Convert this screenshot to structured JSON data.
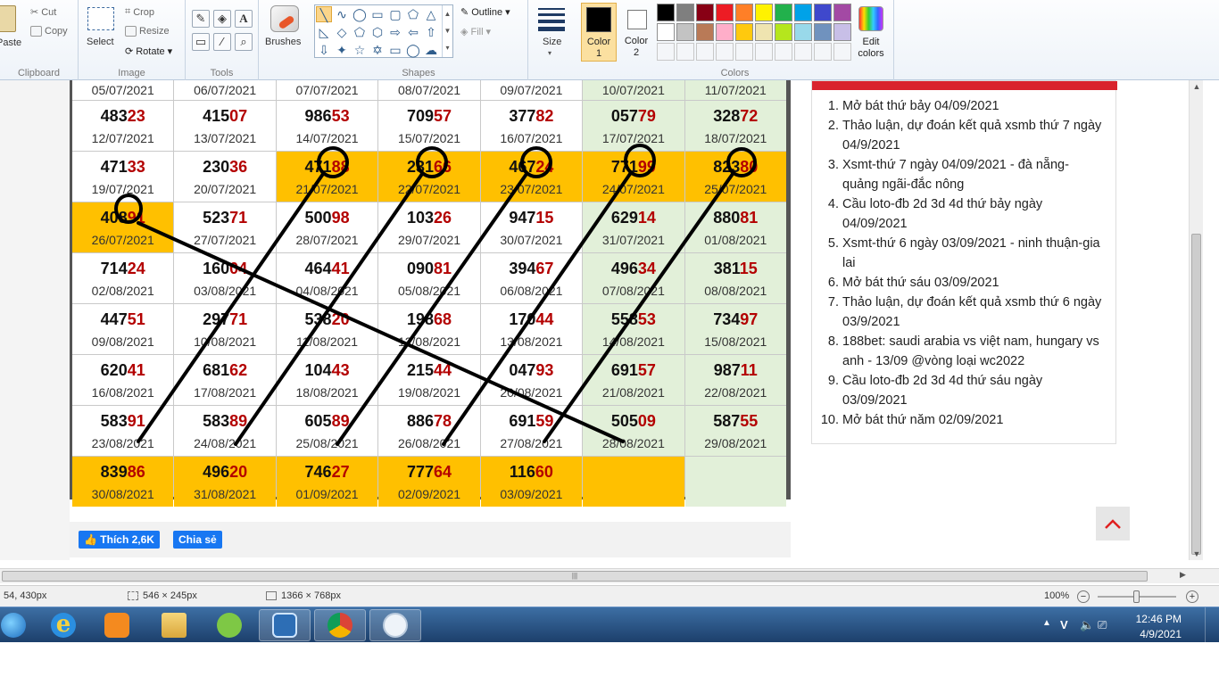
{
  "ribbon": {
    "clipboard": {
      "paste": "Paste",
      "cut": "Cut",
      "copy": "Copy",
      "label": "Clipboard"
    },
    "image": {
      "select": "Select",
      "crop": "Crop",
      "resize": "Resize",
      "rotate": "Rotate",
      "label": "Image"
    },
    "tools": {
      "label": "Tools"
    },
    "brushes": {
      "label": "Brushes"
    },
    "shapes": {
      "outline": "Outline",
      "fill": "Fill",
      "label": "Shapes"
    },
    "size": {
      "label": "Size"
    },
    "colors": {
      "color1": "Color\n1",
      "color2": "Color\n2",
      "edit": "Edit\ncolors",
      "label": "Colors",
      "color1_value": "#000000",
      "color2_value": "#ffffff",
      "palette": [
        "#000000",
        "#7f7f7f",
        "#880015",
        "#ed1c24",
        "#ff7f27",
        "#fff200",
        "#22b14c",
        "#00a2e8",
        "#3f48cc",
        "#a349a4",
        "#ffffff",
        "#c3c3c3",
        "#b97a57",
        "#ffaec9",
        "#ffc90e",
        "#efe4b0",
        "#b5e61d",
        "#99d9ea",
        "#7092be",
        "#c8bfe7"
      ]
    }
  },
  "calendar": {
    "head_row": [
      "05/07/2021",
      "06/07/2021",
      "07/07/2021",
      "08/07/2021",
      "09/07/2021",
      "10/07/2021",
      "11/07/2021"
    ],
    "rows": [
      [
        {
          "a": "483",
          "b": "23",
          "d": "12/07/2021"
        },
        {
          "a": "415",
          "b": "07",
          "d": "13/07/2021"
        },
        {
          "a": "986",
          "b": "53",
          "d": "14/07/2021"
        },
        {
          "a": "709",
          "b": "57",
          "d": "15/07/2021"
        },
        {
          "a": "377",
          "b": "82",
          "d": "16/07/2021"
        },
        {
          "a": "057",
          "b": "79",
          "d": "17/07/2021"
        },
        {
          "a": "328",
          "b": "72",
          "d": "18/07/2021"
        }
      ],
      [
        {
          "a": "471",
          "b": "33",
          "d": "19/07/2021"
        },
        {
          "a": "230",
          "b": "36",
          "d": "20/07/2021"
        },
        {
          "a": "471",
          "b": "88",
          "d": "21/07/2021",
          "hl": true
        },
        {
          "a": "231",
          "b": "66",
          "d": "22/07/2021",
          "hl": true
        },
        {
          "a": "467",
          "b": "24",
          "d": "23/07/2021",
          "hl": true
        },
        {
          "a": "771",
          "b": "99",
          "d": "24/07/2021",
          "hl": true
        },
        {
          "a": "823",
          "b": "80",
          "d": "25/07/2021",
          "hl": true
        }
      ],
      [
        {
          "a": "408",
          "b": "91",
          "d": "26/07/2021",
          "hl": true
        },
        {
          "a": "523",
          "b": "71",
          "d": "27/07/2021"
        },
        {
          "a": "500",
          "b": "98",
          "d": "28/07/2021"
        },
        {
          "a": "103",
          "b": "26",
          "d": "29/07/2021"
        },
        {
          "a": "947",
          "b": "15",
          "d": "30/07/2021"
        },
        {
          "a": "629",
          "b": "14",
          "d": "31/07/2021"
        },
        {
          "a": "880",
          "b": "81",
          "d": "01/08/2021"
        }
      ],
      [
        {
          "a": "714",
          "b": "24",
          "d": "02/08/2021"
        },
        {
          "a": "160",
          "b": "04",
          "d": "03/08/2021"
        },
        {
          "a": "464",
          "b": "41",
          "d": "04/08/2021"
        },
        {
          "a": "090",
          "b": "81",
          "d": "05/08/2021"
        },
        {
          "a": "394",
          "b": "67",
          "d": "06/08/2021"
        },
        {
          "a": "496",
          "b": "34",
          "d": "07/08/2021"
        },
        {
          "a": "381",
          "b": "15",
          "d": "08/08/2021"
        }
      ],
      [
        {
          "a": "447",
          "b": "51",
          "d": "09/08/2021"
        },
        {
          "a": "297",
          "b": "71",
          "d": "10/08/2021"
        },
        {
          "a": "538",
          "b": "20",
          "d": "11/08/2021"
        },
        {
          "a": "198",
          "b": "68",
          "d": "12/08/2021"
        },
        {
          "a": "170",
          "b": "44",
          "d": "13/08/2021"
        },
        {
          "a": "558",
          "b": "53",
          "d": "14/08/2021"
        },
        {
          "a": "734",
          "b": "97",
          "d": "15/08/2021"
        }
      ],
      [
        {
          "a": "620",
          "b": "41",
          "d": "16/08/2021"
        },
        {
          "a": "681",
          "b": "62",
          "d": "17/08/2021"
        },
        {
          "a": "104",
          "b": "43",
          "d": "18/08/2021"
        },
        {
          "a": "215",
          "b": "44",
          "d": "19/08/2021"
        },
        {
          "a": "047",
          "b": "93",
          "d": "20/08/2021"
        },
        {
          "a": "691",
          "b": "57",
          "d": "21/08/2021"
        },
        {
          "a": "987",
          "b": "11",
          "d": "22/08/2021"
        }
      ],
      [
        {
          "a": "583",
          "b": "91",
          "d": "23/08/2021"
        },
        {
          "a": "583",
          "b": "89",
          "d": "24/08/2021"
        },
        {
          "a": "605",
          "b": "89",
          "d": "25/08/2021"
        },
        {
          "a": "886",
          "b": "78",
          "d": "26/08/2021"
        },
        {
          "a": "691",
          "b": "59",
          "d": "27/08/2021"
        },
        {
          "a": "505",
          "b": "09",
          "d": "28/08/2021"
        },
        {
          "a": "587",
          "b": "55",
          "d": "29/08/2021"
        }
      ],
      [
        {
          "a": "839",
          "b": "86",
          "d": "30/08/2021",
          "hl": true
        },
        {
          "a": "496",
          "b": "20",
          "d": "31/08/2021",
          "hl": true
        },
        {
          "a": "746",
          "b": "27",
          "d": "01/09/2021",
          "hl": true
        },
        {
          "a": "777",
          "b": "64",
          "d": "02/09/2021",
          "hl": true
        },
        {
          "a": "116",
          "b": "60",
          "d": "03/09/2021",
          "hl": true
        },
        {
          "a": "",
          "b": "",
          "d": "",
          "hl": true
        },
        {
          "a": "",
          "b": "",
          "d": ""
        }
      ]
    ]
  },
  "share": {
    "like": "Thích 2,6K",
    "share": "Chia sẻ"
  },
  "sidebar": {
    "items": [
      "Mở bát thứ bảy 04/09/2021",
      "Thảo luận, dự đoán kết quả xsmb thứ 7 ngày 04/9/2021",
      "Xsmt-thứ 7 ngày 04/09/2021 - đà nẵng-quảng ngãi-đắc nông",
      "Cầu loto-đb 2d 3d 4d thứ bảy ngày 04/09/2021",
      "Xsmt-thứ 6 ngày 03/09/2021 - ninh thuận-gia lai",
      "Mở bát thứ sáu 03/09/2021",
      "Thảo luận, dự đoán kết quả xsmb thứ 6 ngày 03/9/2021",
      "188bet: saudi arabia vs việt nam, hungary vs anh - 13/09 @vòng loại wc2022",
      "Cầu loto-đb 2d 3d 4d thứ sáu ngày 03/09/2021",
      "Mở bát thứ năm 02/09/2021"
    ],
    "to_top": "^"
  },
  "status": {
    "cursor": "54, 430px",
    "selection": "546 × 245px",
    "image_size": "1366 × 768px",
    "zoom": "100%"
  },
  "taskbar": {
    "apps": [
      "start-orb",
      "internet-explorer",
      "media-player",
      "file-explorer",
      "greenshot",
      "remote-desktop",
      "chrome",
      "paint"
    ],
    "tray_lang": "V",
    "time": "12:46 PM",
    "date": "4/9/2021"
  }
}
